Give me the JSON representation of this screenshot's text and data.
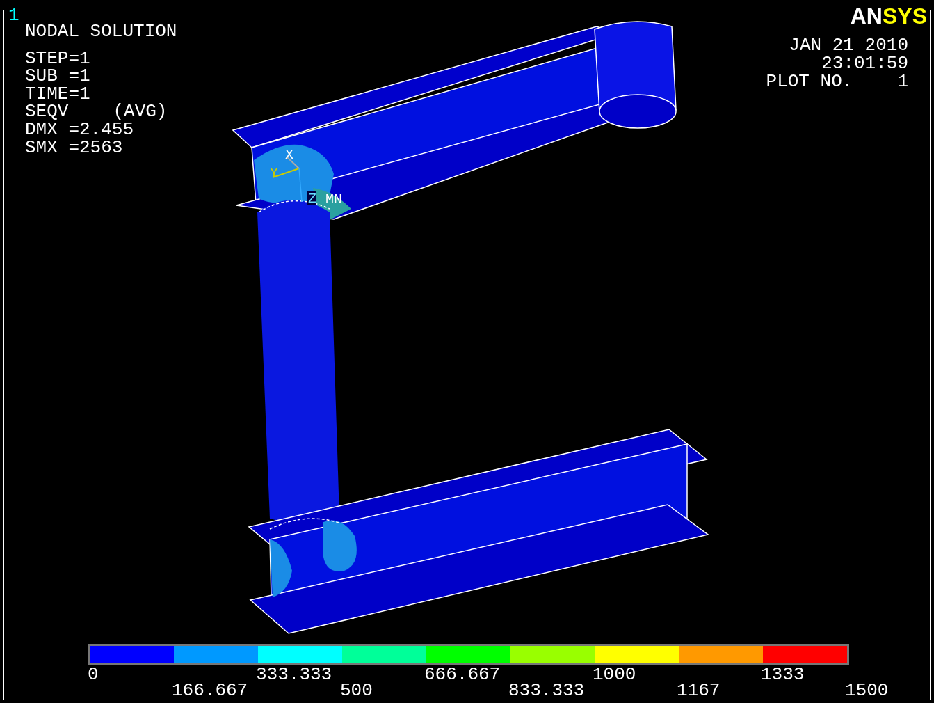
{
  "window_number": "1",
  "header": {
    "title": "NODAL SOLUTION",
    "lines": [
      "STEP=1",
      "SUB =1",
      "TIME=1"
    ],
    "result": {
      "label": "SEQV",
      "qualifier": "(AVG)"
    },
    "extremes": [
      "DMX =2.455",
      "SMX =2563"
    ]
  },
  "logo": {
    "parts": [
      {
        "text": "AN",
        "color": "#ffffff"
      },
      {
        "text": "SYS",
        "color": "#ffff00"
      }
    ]
  },
  "stamp": {
    "date": "JAN 21 2010",
    "time": "23:01:59",
    "plot_label": "PLOT NO.",
    "plot_number": "1"
  },
  "triad": {
    "x": "X",
    "y": "Y",
    "z": "Z"
  },
  "min_marker": "MN",
  "legend": {
    "segments": [
      {
        "color": "#0000ff"
      },
      {
        "color": "#0099ff"
      },
      {
        "color": "#00ffff"
      },
      {
        "color": "#00ff99"
      },
      {
        "color": "#00ff00"
      },
      {
        "color": "#99ff00"
      },
      {
        "color": "#ffff00"
      },
      {
        "color": "#ff9900"
      },
      {
        "color": "#ff0000"
      }
    ],
    "labels": [
      "0",
      "166.667",
      "333.333",
      "500",
      "666.667",
      "833.333",
      "1000",
      "1167",
      "1333",
      "1500"
    ]
  }
}
